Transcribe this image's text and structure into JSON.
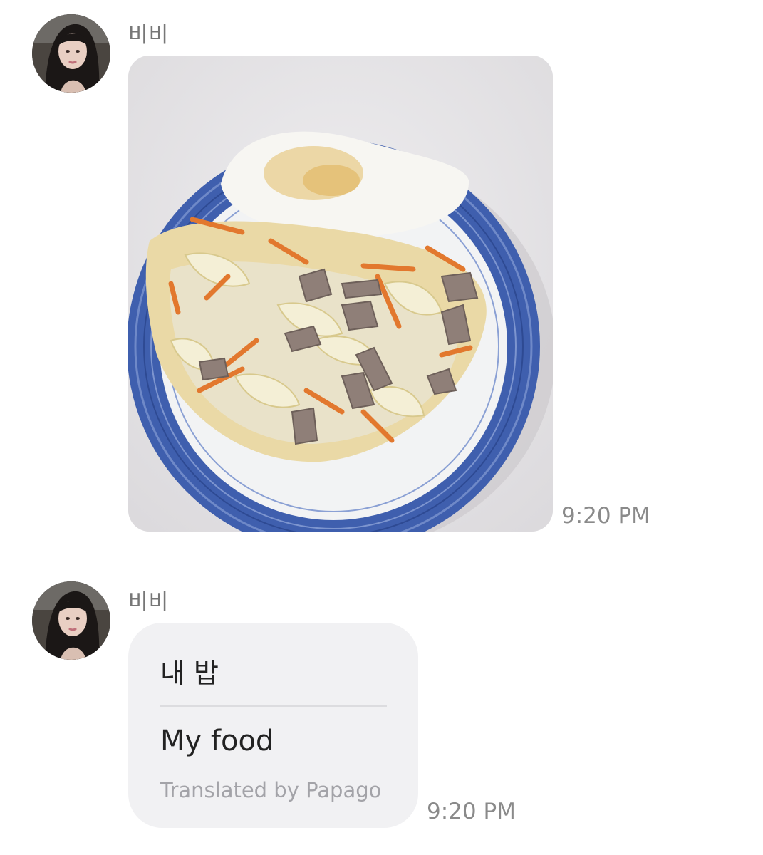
{
  "messages": [
    {
      "sender": "비비",
      "type": "image",
      "image_description": "plate-of-stir-fried-cabbage-carrot-pork-with-fried-egg",
      "time": "9:20 PM"
    },
    {
      "sender": "비비",
      "type": "translated_text",
      "original": "내 밥",
      "translation": "My food",
      "credit": "Translated by Papago",
      "time": "9:20 PM"
    }
  ],
  "colors": {
    "bubble_bg": "#f1f1f3",
    "timestamp": "#8a8a8a",
    "sender_name": "#777777",
    "plate_rim": "#3f5fae"
  }
}
